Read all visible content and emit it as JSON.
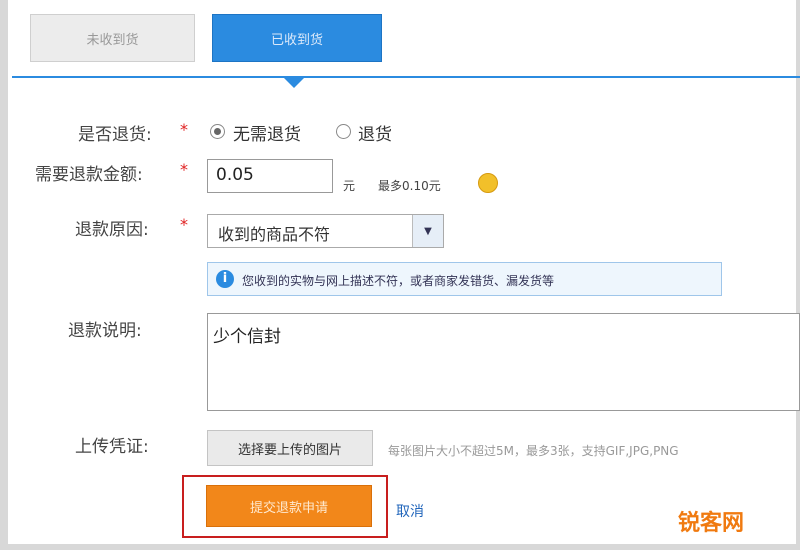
{
  "tabs": {
    "unreceived": "未收到货",
    "received": "已收到货"
  },
  "form": {
    "return_goods": {
      "label": "是否退货:",
      "required": "*",
      "option_no_return": "无需退货",
      "option_return": "退货"
    },
    "refund_amount": {
      "label": "需要退款金额:",
      "required": "*",
      "value": "0.05",
      "unit": "元",
      "max_hint": "最多0.10元"
    },
    "refund_reason": {
      "label": "退款原因:",
      "required": "*",
      "selected": "收到的商品不符",
      "notice": "您收到的实物与网上描述不符，或者商家发错货、漏发货等"
    },
    "refund_description": {
      "label": "退款说明:",
      "value": "少个信封"
    },
    "upload": {
      "label": "上传凭证:",
      "button": "选择要上传的图片",
      "hint": "每张图片大小不超过5M，最多3张，支持GIF,JPG,PNG"
    },
    "actions": {
      "submit": "提交退款申请",
      "cancel": "取消"
    }
  },
  "watermark": "锐客网",
  "colors": {
    "tab_active": "#2b8be0",
    "submit": "#f2871a",
    "required": "#e02020",
    "highlight": "#c81e1e"
  }
}
